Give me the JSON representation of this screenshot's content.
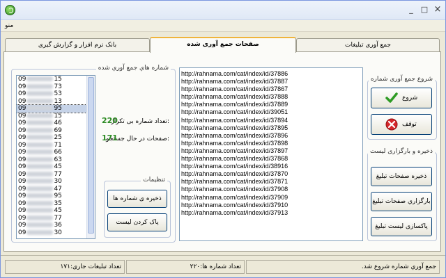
{
  "window": {
    "title": "",
    "minimize_glyph": "_",
    "maximize_glyph": "□",
    "close_glyph": "×"
  },
  "menu": {
    "label": "منو"
  },
  "tabs": [
    {
      "label": "بانک نرم افزار و گزارش گیری",
      "active": false
    },
    {
      "label": "صفحات جمع آوری شده",
      "active": true
    },
    {
      "label": "جمع آوری تبلیغات",
      "active": false
    }
  ],
  "numbers_group": {
    "title": "شماره هاي جمع آوري شده",
    "items": [
      {
        "prefix": "09",
        "suffix": "15",
        "selected": false
      },
      {
        "prefix": "09",
        "suffix": "73",
        "selected": false
      },
      {
        "prefix": "09",
        "suffix": "53",
        "selected": false
      },
      {
        "prefix": "09",
        "suffix": "13",
        "selected": false
      },
      {
        "prefix": "09",
        "suffix": "95",
        "selected": true
      },
      {
        "prefix": "09",
        "suffix": "15",
        "selected": false
      },
      {
        "prefix": "09",
        "suffix": "46",
        "selected": false
      },
      {
        "prefix": "09",
        "suffix": "69",
        "selected": false
      },
      {
        "prefix": "09",
        "suffix": "25",
        "selected": false
      },
      {
        "prefix": "09",
        "suffix": "71",
        "selected": false
      },
      {
        "prefix": "09",
        "suffix": "66",
        "selected": false
      },
      {
        "prefix": "09",
        "suffix": "63",
        "selected": false
      },
      {
        "prefix": "09",
        "suffix": "45",
        "selected": false
      },
      {
        "prefix": "09",
        "suffix": "77",
        "selected": false
      },
      {
        "prefix": "09",
        "suffix": "30",
        "selected": false
      },
      {
        "prefix": "09",
        "suffix": "47",
        "selected": false
      },
      {
        "prefix": "09",
        "suffix": "95",
        "selected": false
      },
      {
        "prefix": "09",
        "suffix": "35",
        "selected": false
      },
      {
        "prefix": "09",
        "suffix": "45",
        "selected": false
      },
      {
        "prefix": "09",
        "suffix": "77",
        "selected": false
      },
      {
        "prefix": "09",
        "suffix": "36",
        "selected": false
      },
      {
        "prefix": "09",
        "suffix": "30",
        "selected": false
      }
    ]
  },
  "stats": {
    "unique_label": "تعداد شماره بی تکرار:",
    "unique_value": "220",
    "searching_label": "صفحات در حال جستجو:",
    "searching_value": "171"
  },
  "settings_group": {
    "title": "تنظیمات",
    "save_numbers": "ذخیره ی شماره ها",
    "clear_list": "پاک کردن لیست"
  },
  "urls": [
    "http://rahnama.com/cat/index/id/37886",
    "http://rahnama.com/cat/index/id/37887",
    "http://rahnama.com/cat/index/id/37867",
    "http://rahnama.com/cat/index/id/37888",
    "http://rahnama.com/cat/index/id/37889",
    "http://rahnama.com/cat/index/id/39051",
    "http://rahnama.com/cat/index/id/37894",
    "http://rahnama.com/cat/index/id/37895",
    "http://rahnama.com/cat/index/id/37896",
    "http://rahnama.com/cat/index/id/37898",
    "http://rahnama.com/cat/index/id/37897",
    "http://rahnama.com/cat/index/id/37868",
    "http://rahnama.com/cat/index/id/38916",
    "http://rahnama.com/cat/index/id/37870",
    "http://rahnama.com/cat/index/id/37871",
    "http://rahnama.com/cat/index/id/37908",
    "http://rahnama.com/cat/index/id/37909",
    "http://rahnama.com/cat/index/id/37910",
    "http://rahnama.com/cat/index/id/37913"
  ],
  "collect_group": {
    "title": "شروع جمع آوری شماره",
    "start": "شروع",
    "stop": "توقف"
  },
  "save_group": {
    "title": "ذخیره و بارگزاری لیست",
    "save_pages": "ذخیره صفحات تبلیغ",
    "load_pages": "بارگزاري صفحات تبليغ",
    "clear_ads_list": "پاکسازی لیست تبلیغ"
  },
  "status": {
    "message": ".جمع آوري شماره شروع شد",
    "numbers_count": "تعداد شماره ها:۲۲۰",
    "current_ads": "تعداد تبلیغات جاری:۱۷۱"
  },
  "colors": {
    "accent_green": "#2b8a22",
    "tab_highlight": "#f0b43c"
  }
}
